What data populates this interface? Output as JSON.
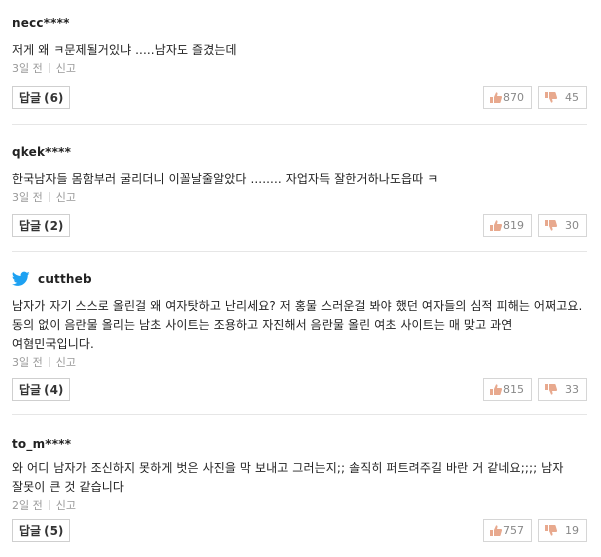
{
  "colors": {
    "twitter": "#1DA1F2",
    "thumb": "#e8a98e",
    "border": "#e6e6e6"
  },
  "comments": [
    {
      "user": "necc****",
      "platform_icon": "",
      "text": "저게 왜 ㅋ문제될거있냐 .....남자도 즐겼는데",
      "time": "3일 전",
      "report": "신고",
      "reply_label": "답글",
      "reply_count": "(6)",
      "likes": "870",
      "dislikes": "45"
    },
    {
      "user": "qkek****",
      "platform_icon": "",
      "text": "한국남자들 몸함부러 굴리더니 이꼴날줄알았다 ........ 자업자득 잘한거하나도읍따 ㅋ",
      "time": "3일 전",
      "report": "신고",
      "reply_label": "답글",
      "reply_count": "(2)",
      "likes": "819",
      "dislikes": "30"
    },
    {
      "user": "cuttheb",
      "platform_icon": "twitter-icon",
      "text": "남자가 자기 스스로 올린걸 왜 여자탓하고 난리세요? 저 홍물 스러운걸 봐야 했던 여자들의 심적 피해는 어쩌고요. 동의 없이 음란물 올리는 남초 사이트는 조용하고 자진해서 음란물 올린 여초 사이트는 매 맞고 과연 여혐민국입니다.",
      "time": "3일 전",
      "report": "신고",
      "reply_label": "답글",
      "reply_count": "(4)",
      "likes": "815",
      "dislikes": "33"
    },
    {
      "user": "to_m****",
      "platform_icon": "",
      "text": "와 어디 남자가 조신하지 못하게 벗은 사진을 막 보내고 그러는지;; 솔직히 퍼트려주길 바란 거 같네요;;;; 남자 잘못이 큰 것 같습니다",
      "time": "2일 전",
      "report": "신고",
      "reply_label": "답글",
      "reply_count": "(5)",
      "likes": "757",
      "dislikes": "19"
    }
  ]
}
